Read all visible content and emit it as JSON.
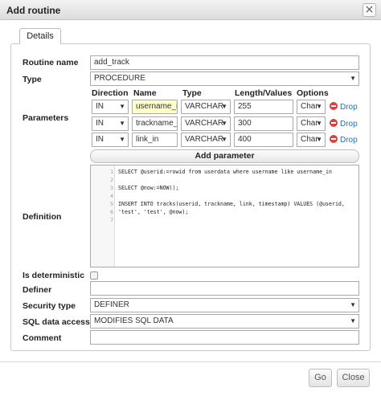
{
  "dialog": {
    "title": "Add routine",
    "close_glyph": "×"
  },
  "tab": {
    "label": "Details"
  },
  "labels": {
    "routine_name": "Routine name",
    "type": "Type",
    "parameters": "Parameters",
    "definition": "Definition",
    "is_deterministic": "Is deterministic",
    "definer": "Definer",
    "security_type": "Security type",
    "sql_data_access": "SQL data access",
    "comment": "Comment"
  },
  "fields": {
    "routine_name": "add_track",
    "type": "PROCEDURE",
    "definer": "",
    "security_type": "DEFINER",
    "sql_data_access": "MODIFIES SQL DATA",
    "comment": "",
    "is_deterministic": false
  },
  "param_columns": [
    "Direction",
    "Name",
    "Type",
    "Length/Values",
    "Options"
  ],
  "parameters": [
    {
      "direction": "IN",
      "name": "username_i",
      "type": "VARCHAR",
      "length": "255",
      "options": "Char",
      "drop": "Drop"
    },
    {
      "direction": "IN",
      "name": "trackname_",
      "type": "VARCHAR",
      "length": "300",
      "options": "Char",
      "drop": "Drop"
    },
    {
      "direction": "IN",
      "name": "link_in",
      "type": "VARCHAR",
      "length": "400",
      "options": "Char",
      "drop": "Drop"
    }
  ],
  "add_parameter_label": "Add parameter",
  "definition": {
    "line_numbers": [
      "1",
      "2",
      "3",
      "4",
      "5",
      "6",
      "7"
    ],
    "lines": [
      "SELECT @userid:=rowid from userdata where username like username_in",
      "",
      "SELECT @now:=NOW();",
      "",
      "INSERT INTO tracks(userid, trackname, link, timestamp) VALUES (@userid,",
      "'test', 'test', @now);",
      ""
    ]
  },
  "buttons": {
    "go": "Go",
    "close": "Close"
  },
  "icons": {
    "dropdown": "chevron-down-icon",
    "drop": "drop-circle-icon",
    "close": "close-icon"
  },
  "colors": {
    "highlight_input": "#ffffc9",
    "drop_icon": "#d9433a",
    "link": "#2a6ebb"
  }
}
